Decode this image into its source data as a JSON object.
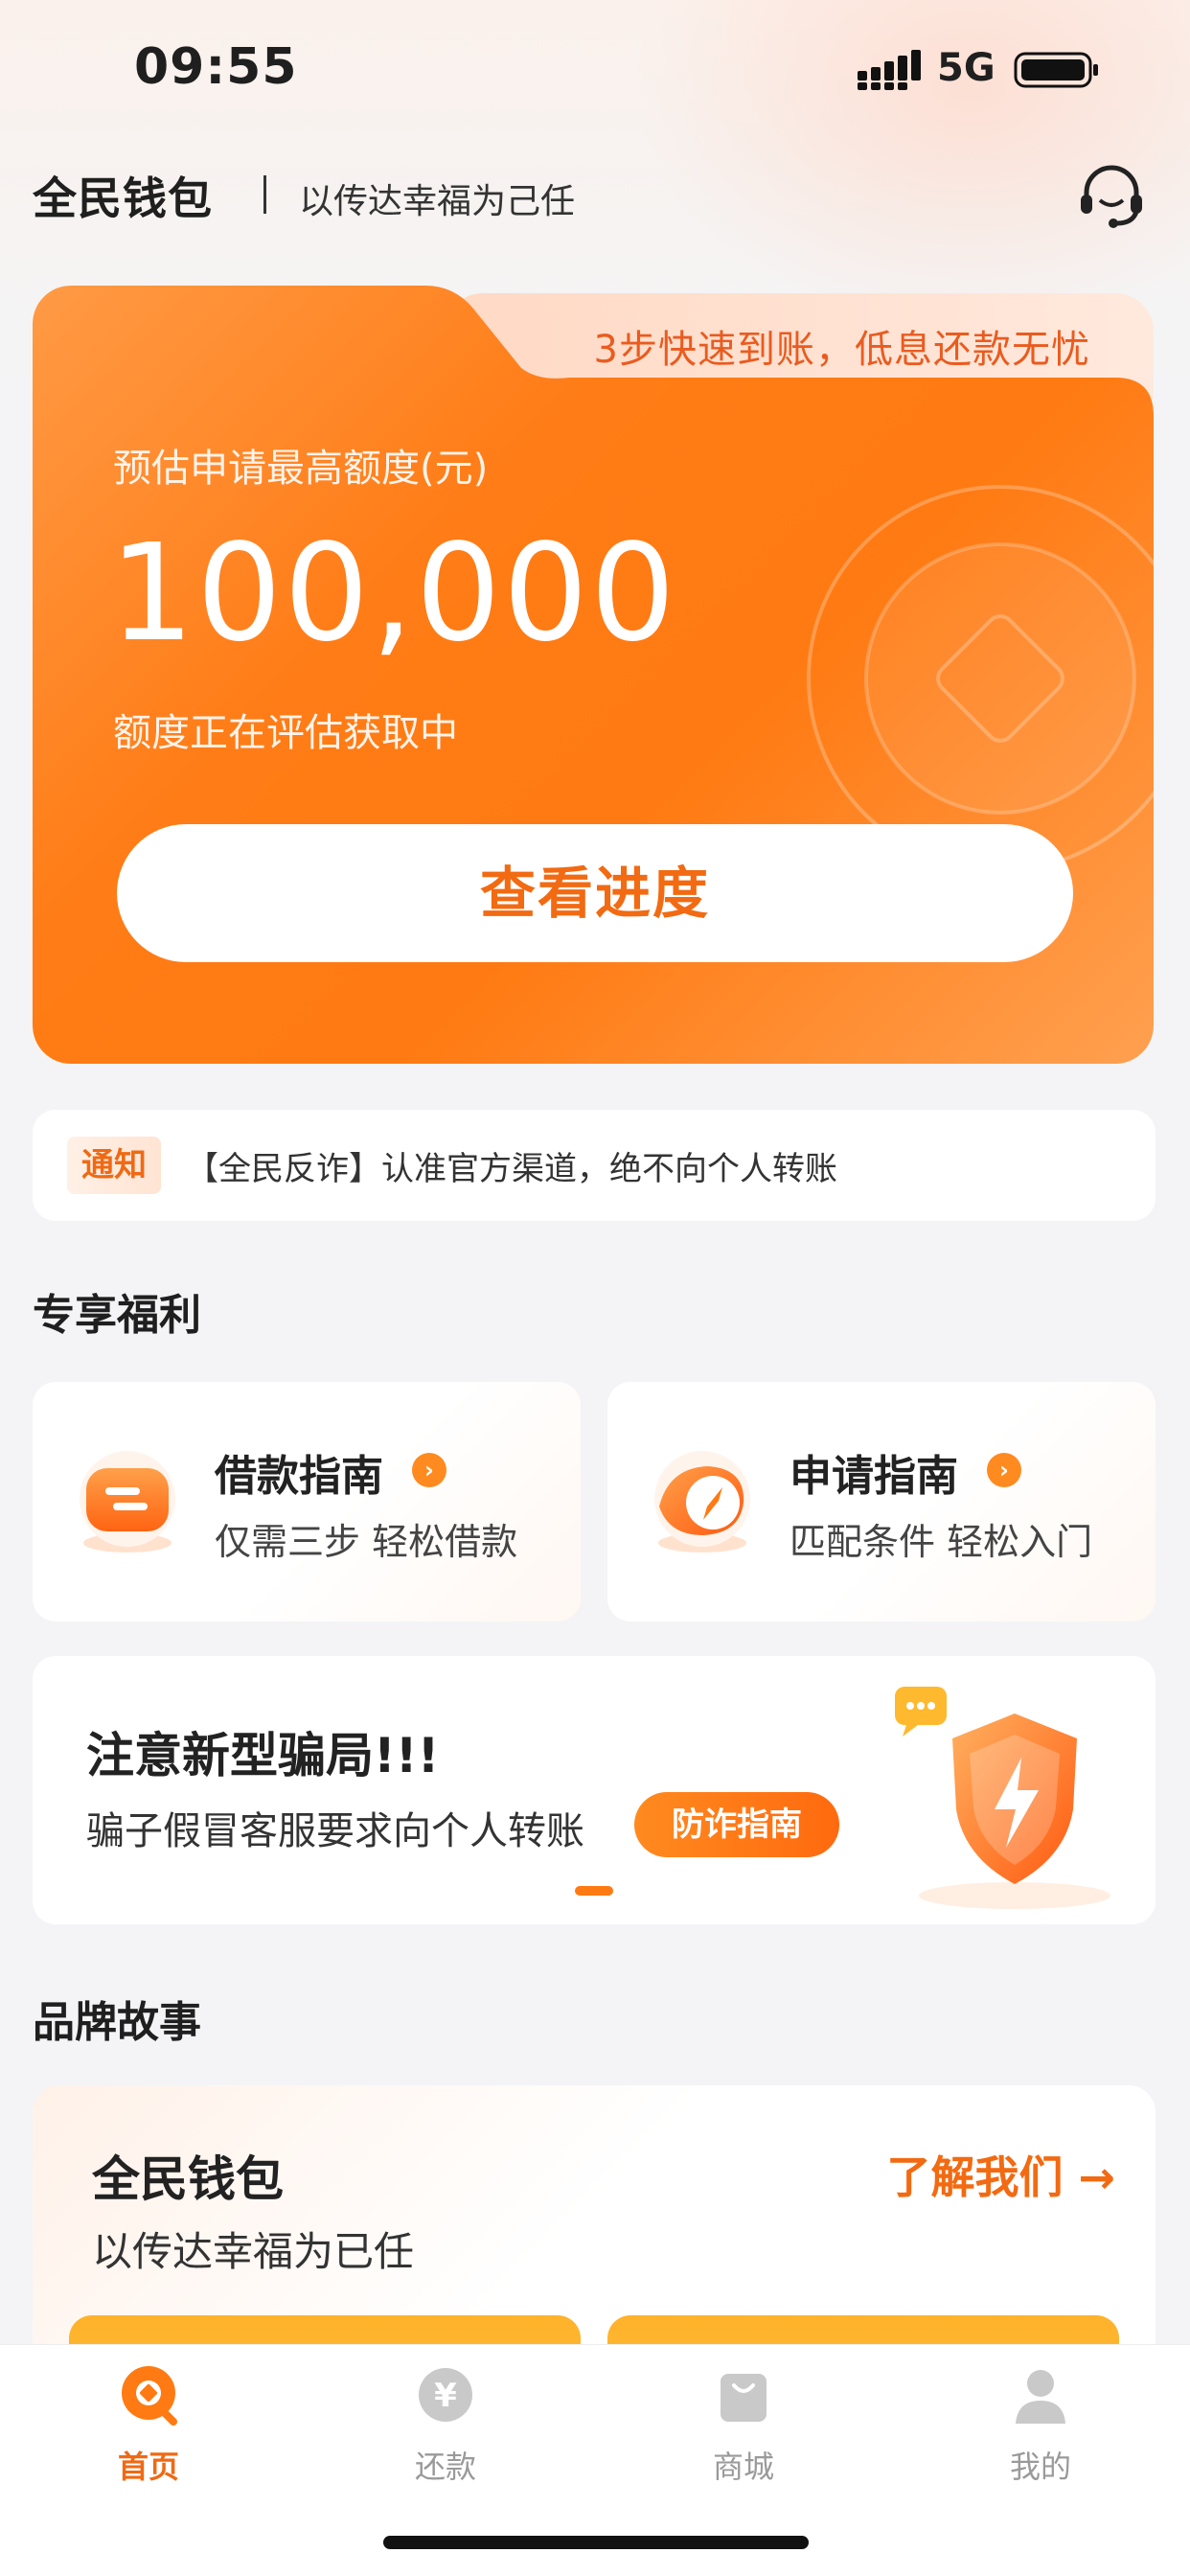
{
  "status_bar": {
    "time": "09:55",
    "network": "5G"
  },
  "header": {
    "app_name": "全民钱包",
    "tagline": "以传达幸福为己任",
    "icon": "customer-service-headset-icon"
  },
  "hero": {
    "promo": "3步快速到账，低息还款无忧",
    "label": "预估申请最高额度(元)",
    "amount": "100,000",
    "status": "额度正在评估获取中",
    "button": "查看进度"
  },
  "notice": {
    "badge": "通知",
    "text": "【全民反诈】认准官方渠道，绝不向个人转账"
  },
  "benefits": {
    "section_title": "专享福利",
    "items": [
      {
        "title": "借款指南",
        "subtitle": "仅需三步 轻松借款",
        "icon": "loan-guide-icon"
      },
      {
        "title": "申请指南",
        "subtitle": "匹配条件 轻松入门",
        "icon": "compass-icon"
      }
    ]
  },
  "banner": {
    "title": "注意新型骗局!!!",
    "subtitle": "骗子假冒客服要求向个人转账",
    "button": "防诈指南",
    "icon": "shield-lightning-icon"
  },
  "brand": {
    "section_title": "品牌故事",
    "title": "全民钱包",
    "subtitle": "以传达幸福为已任",
    "link": "了解我们 →"
  },
  "tabbar": {
    "items": [
      {
        "label": "首页",
        "icon": "home-icon",
        "active": true
      },
      {
        "label": "还款",
        "icon": "yen-icon",
        "active": false
      },
      {
        "label": "商城",
        "icon": "shopping-bag-icon",
        "active": false
      },
      {
        "label": "我的",
        "icon": "user-icon",
        "active": false
      }
    ]
  },
  "colors": {
    "accent": "#ff7a12",
    "accent_text": "#ef6a14",
    "background": "#f4f4f6"
  }
}
